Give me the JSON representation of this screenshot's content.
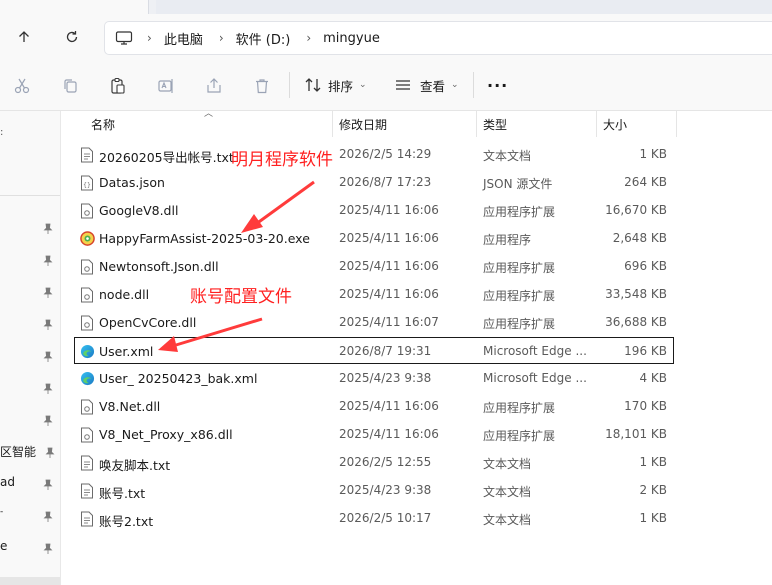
{
  "breadcrumb": {
    "items": [
      "此电脑",
      "软件 (D:)",
      "mingyue"
    ]
  },
  "toolbar": {
    "sort_label": "排序",
    "view_label": "查看",
    "more_label": "···"
  },
  "navpane": {
    "items": [
      "区智能",
      "ad",
      "-",
      "e"
    ]
  },
  "columns": {
    "name": "名称",
    "date": "修改日期",
    "type": "类型",
    "size": "大小"
  },
  "files": [
    {
      "name": "20260205导出帐号.txt",
      "date": "2026/2/5 14:29",
      "type": "文本文档",
      "size": "1 KB",
      "icon": "text-file-icon"
    },
    {
      "name": "Datas.json",
      "date": "2026/8/7 17:23",
      "type": "JSON 源文件",
      "size": "264 KB",
      "icon": "json-file-icon"
    },
    {
      "name": "GoogleV8.dll",
      "date": "2025/4/11 16:06",
      "type": "应用程序扩展",
      "size": "16,670 KB",
      "icon": "dll-file-icon"
    },
    {
      "name": "HappyFarmAssist-2025-03-20.exe",
      "date": "2025/4/11 16:06",
      "type": "应用程序",
      "size": "2,648 KB",
      "icon": "app-icon"
    },
    {
      "name": "Newtonsoft.Json.dll",
      "date": "2025/4/11 16:06",
      "type": "应用程序扩展",
      "size": "696 KB",
      "icon": "dll-file-icon"
    },
    {
      "name": "node.dll",
      "date": "2025/4/11 16:06",
      "type": "应用程序扩展",
      "size": "33,548 KB",
      "icon": "dll-file-icon"
    },
    {
      "name": "OpenCvCore.dll",
      "date": "2025/4/11 16:07",
      "type": "应用程序扩展",
      "size": "36,688 KB",
      "icon": "dll-file-icon"
    },
    {
      "name": "User.xml",
      "date": "2026/8/7 19:31",
      "type": "Microsoft Edge ...",
      "size": "196 KB",
      "icon": "edge-icon"
    },
    {
      "name": "User_ 20250423_bak.xml",
      "date": "2025/4/23 9:38",
      "type": "Microsoft Edge ...",
      "size": "4 KB",
      "icon": "edge-icon"
    },
    {
      "name": "V8.Net.dll",
      "date": "2025/4/11 16:06",
      "type": "应用程序扩展",
      "size": "170 KB",
      "icon": "dll-file-icon"
    },
    {
      "name": "V8_Net_Proxy_x86.dll",
      "date": "2025/4/11 16:06",
      "type": "应用程序扩展",
      "size": "18,101 KB",
      "icon": "dll-file-icon"
    },
    {
      "name": "唤友脚本.txt",
      "date": "2026/2/5 12:55",
      "type": "文本文档",
      "size": "1 KB",
      "icon": "text-file-icon"
    },
    {
      "name": "账号.txt",
      "date": "2025/4/23 9:38",
      "type": "文本文档",
      "size": "2 KB",
      "icon": "text-file-icon"
    },
    {
      "name": "账号2.txt",
      "date": "2026/2/5 10:17",
      "type": "文本文档",
      "size": "1 KB",
      "icon": "text-file-icon"
    }
  ],
  "annotations": {
    "program_label": "明月程序软件",
    "config_label": "账号配置文件",
    "color": "#ff2020"
  }
}
